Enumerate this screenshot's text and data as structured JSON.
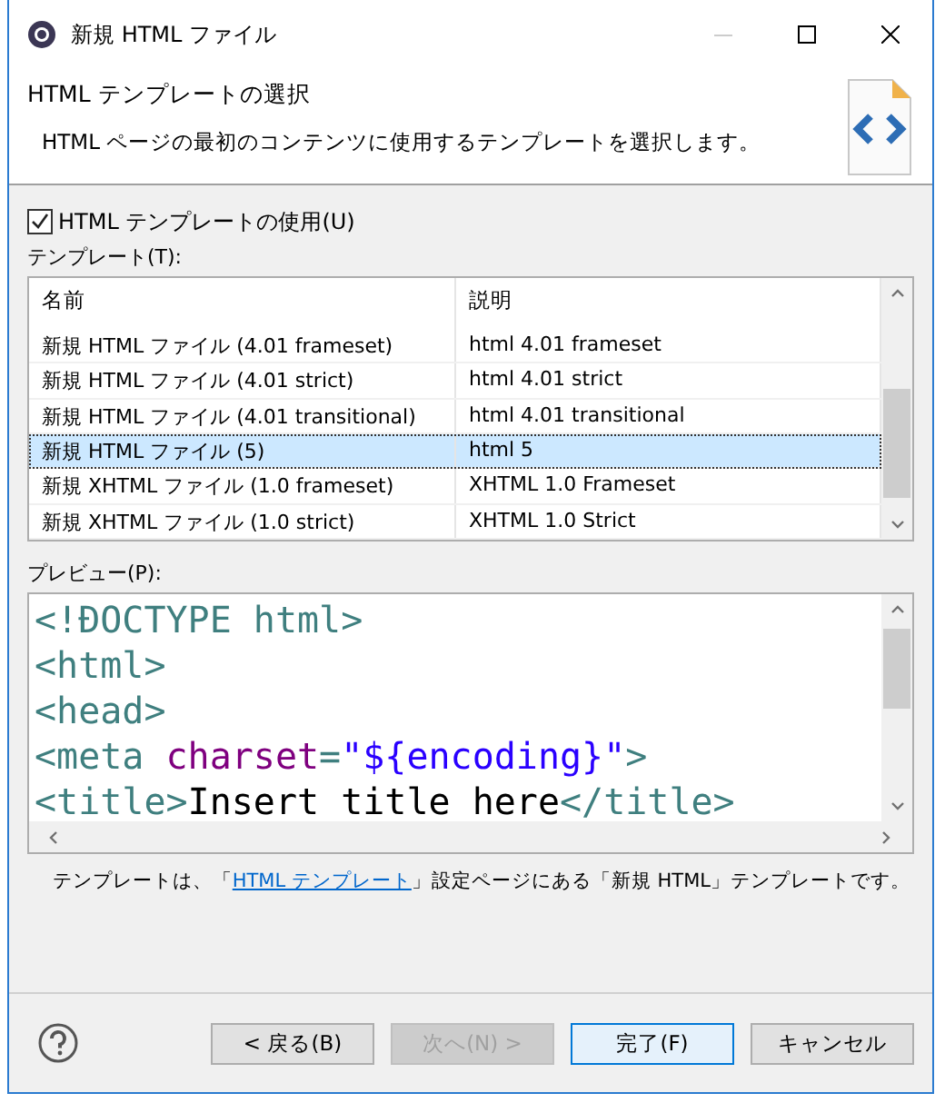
{
  "window": {
    "title": "新規 HTML ファイル"
  },
  "header": {
    "title": "HTML テンプレートの選択",
    "description": "HTML ページの最初のコンテンツに使用するテンプレートを選択します。"
  },
  "use_template": {
    "label": "HTML テンプレートの使用(U)",
    "checked": true
  },
  "templates": {
    "label": "テンプレート(T):",
    "columns": [
      "名前",
      "説明"
    ],
    "rows": [
      {
        "name": "新規 HTML ファイル (4.01 frameset)",
        "description": "html 4.01 frameset",
        "selected": false
      },
      {
        "name": "新規 HTML ファイル (4.01 strict)",
        "description": "html 4.01 strict",
        "selected": false
      },
      {
        "name": "新規 HTML ファイル (4.01 transitional)",
        "description": "html 4.01 transitional",
        "selected": false
      },
      {
        "name": "新規 HTML ファイル (5)",
        "description": "html 5",
        "selected": true
      },
      {
        "name": "新規 XHTML ファイル (1.0 frameset)",
        "description": "XHTML 1.0 Frameset",
        "selected": false
      },
      {
        "name": "新規 XHTML ファイル (1.0 strict)",
        "description": "XHTML 1.0 Strict",
        "selected": false
      }
    ]
  },
  "preview": {
    "label": "プレビュー(P):",
    "lines": [
      [
        {
          "kind": "tag",
          "text": "<!ĐOCTYPE html>"
        }
      ],
      [
        {
          "kind": "tag",
          "text": "<html>"
        }
      ],
      [
        {
          "kind": "tag",
          "text": "<head>"
        }
      ],
      [
        {
          "kind": "tag",
          "text": "<meta "
        },
        {
          "kind": "attr",
          "text": "charset"
        },
        {
          "kind": "tag",
          "text": "="
        },
        {
          "kind": "string",
          "text": "\"${encoding}\""
        },
        {
          "kind": "tag",
          "text": ">"
        }
      ],
      [
        {
          "kind": "tag",
          "text": "<title>"
        },
        {
          "kind": "text",
          "text": "Insert title here"
        },
        {
          "kind": "tag",
          "text": "</title>"
        }
      ]
    ]
  },
  "note": [
    {
      "kind": "text",
      "text": "テンプレートは、「"
    },
    {
      "kind": "link",
      "text": "HTML テンプレート"
    },
    {
      "kind": "text",
      "text": "」設定ページにある「新規 HTML」テンプレートです。"
    }
  ],
  "buttons": [
    {
      "label": "< 戻る(B)",
      "disabled": false,
      "default": false
    },
    {
      "label": "次へ(N) >",
      "disabled": true,
      "default": false
    },
    {
      "label": "完了(F)",
      "disabled": false,
      "default": true
    },
    {
      "label": "キャンセル",
      "disabled": false,
      "default": false
    }
  ]
}
